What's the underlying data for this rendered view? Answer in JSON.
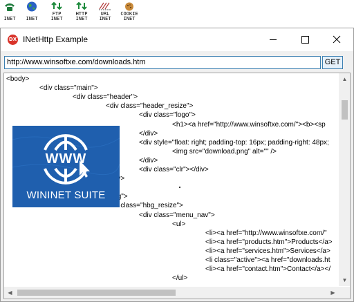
{
  "toolbar": {
    "items": [
      {
        "name": "phone-icon",
        "label": "\nINET"
      },
      {
        "name": "globe-icon",
        "label": "\nINET"
      },
      {
        "name": "ftp-icon",
        "label": "FTP\nINET"
      },
      {
        "name": "http-icon",
        "label": "HTTP\nINET"
      },
      {
        "name": "url-icon",
        "label": "URL\nINET"
      },
      {
        "name": "cookie-icon",
        "label": "COOKIE\nINET"
      }
    ]
  },
  "window": {
    "title": "INetHttp Example",
    "icon_text": "DX"
  },
  "url_bar": {
    "value": "http://www.winsoftxe.com/downloads.htm",
    "get_label": "GET"
  },
  "code": {
    "lines": [
      {
        "indent": 0,
        "text": "<body>"
      },
      {
        "indent": 1,
        "text": "<div class=\"main\">"
      },
      {
        "indent": 2,
        "text": "<div class=\"header\">"
      },
      {
        "indent": 3,
        "text": "<div class=\"header_resize\">"
      },
      {
        "indent": 4,
        "text": "<div class=\"logo\">"
      },
      {
        "indent": 5,
        "text": "<h1><a href=\"http://www.winsoftxe.com/\"><b><sp"
      },
      {
        "indent": 4,
        "text": "</div>"
      },
      {
        "indent": 4,
        "text": "<div style=\"float: right; padding-top: 16px; padding-right: 48px;"
      },
      {
        "indent": 5,
        "text": "<img src=\"download.png\" alt=\"\" />"
      },
      {
        "indent": 4,
        "text": "</div>"
      },
      {
        "indent": 4,
        "text": "<div class=\"clr\"></div>"
      },
      {
        "indent": 3,
        "text": "</div>"
      },
      {
        "indent": 2,
        "text": ""
      },
      {
        "indent": 2,
        "text": "<div class=\"hbg\">"
      },
      {
        "indent": 3,
        "text": "<div class=\"hbg_resize\">"
      },
      {
        "indent": 4,
        "text": "<div class=\"menu_nav\">"
      },
      {
        "indent": 5,
        "text": "<ul>"
      },
      {
        "indent": 6,
        "text": "<li><a href=\"http://www.winsoftxe.com/\""
      },
      {
        "indent": 6,
        "text": "<li><a href=\"products.htm\">Products</a>"
      },
      {
        "indent": 6,
        "text": "<li><a href=\"services.htm\">Services</a>"
      },
      {
        "indent": 6,
        "text": "<li class=\"active\"><a href=\"downloads.ht"
      },
      {
        "indent": 6,
        "text": "<li><a href=\"contact.htm\">Contact</a></"
      },
      {
        "indent": 5,
        "text": "</ul>"
      }
    ]
  },
  "splash": {
    "caption": "WININET SUITE",
    "logo_text": "WWW",
    "background": "#1f5fae"
  },
  "colors": {
    "accent": "#3c7fb1",
    "splash_blue": "#1f5fae",
    "icon_red": "#d9342b"
  }
}
